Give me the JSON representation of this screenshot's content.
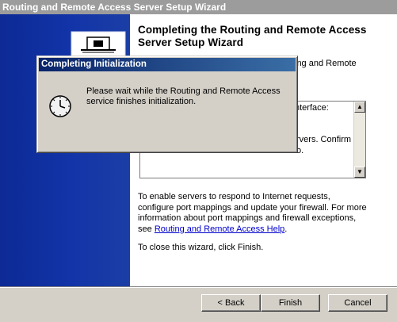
{
  "window": {
    "title": "Routing and Remote Access Server Setup Wizard"
  },
  "page": {
    "heading": "Completing the Routing and Remote Access Server Setup Wizard",
    "partial_intro": "ing and Remote",
    "partial_interface": "nterface:",
    "partial_confirm": "rvers. Confirm",
    "partial_last": "o.",
    "firewall_text": "To enable servers to respond to Internet requests, configure port mappings and update your firewall. For more information about port mappings and firewall exceptions, see",
    "help_link": "Routing and Remote Access Help",
    "help_link_suffix": ".",
    "close_text": "To close this wizard, click Finish."
  },
  "buttons": {
    "back": "< Back",
    "finish": "Finish",
    "cancel": "Cancel"
  },
  "dialog": {
    "title": "Completing Initialization",
    "message": "Please wait while the Routing and Remote Access service finishes initialization."
  },
  "icons": {
    "wizard_logo": "computer-network-icon",
    "wait": "clock-icon"
  }
}
